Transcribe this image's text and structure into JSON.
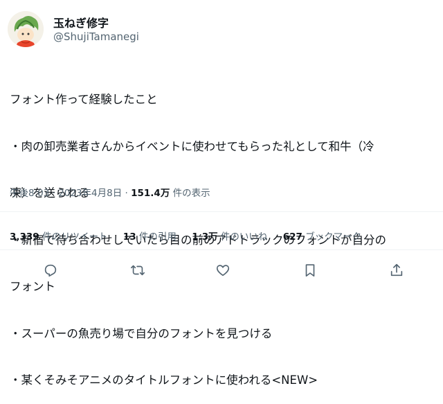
{
  "author": {
    "name": "玉ねぎ修字",
    "handle": "@ShujiTamanegi"
  },
  "tweet": {
    "lines": [
      "フォント作って経験したこと",
      "・肉の卸売業者さんからイベントに使わせてもらった礼として和牛（冷",
      "凍）を送られる",
      "・新宿で待ち合わせしていたら目の前のアドトラックのフォントが自分の",
      "フォント",
      "・スーパーの魚売り場で自分のフォントを見つける",
      "・某くそみそアニメのタイトルフォントに使われる<NEW>"
    ]
  },
  "meta": {
    "time": "午後8:03",
    "sep1": " · ",
    "date": "2023年4月8日",
    "sep2": " · ",
    "views_count": "151.4万",
    "views_label": " 件の表示"
  },
  "stats": {
    "retweets_count": "3,339",
    "retweets_label": " 件のリツイート",
    "quotes_count": "13",
    "quotes_label": " 件の引用",
    "likes_count": "1.3万",
    "likes_label": " 件のいいね",
    "bookmarks_count": "627",
    "bookmarks_label": " ブックマーク"
  },
  "actions": [
    "reply-icon",
    "retweet-icon",
    "like-icon",
    "bookmark-icon",
    "share-icon"
  ],
  "colors": {
    "text": "#0f1419",
    "secondary": "#536471",
    "divider": "#eff3f4",
    "icon": "#536471"
  }
}
